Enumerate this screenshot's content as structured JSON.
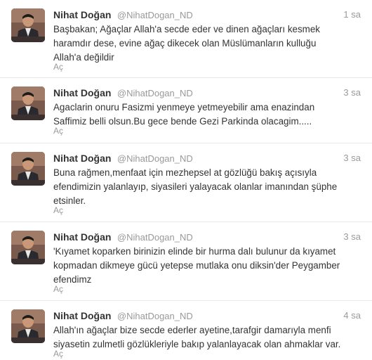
{
  "colors": {
    "name_text": "#333333",
    "meta_text": "#999999",
    "divider": "#e8e8e8",
    "avatar_bg": "#8c6a5a"
  },
  "tweets": [
    {
      "fullname": "Nihat Doğan",
      "username": "@NihatDogan_ND",
      "time": "1 sa",
      "text": "Başbakan; Ağaçlar Allah'a secde eder ve dinen ağaçları kesmek\nharamdır dese, evine ağaç dikecek olan Müslümanların kulluğu\nAllah'a değildir",
      "expand": "Aç"
    },
    {
      "fullname": "Nihat Doğan",
      "username": "@NihatDogan_ND",
      "time": "3 sa",
      "text": "Agaclarin onuru Fasizmi yenmeye yetmeyebilir ama enazindan\nSaffimiz belli olsun.Bu gece bende Gezi Parkinda olacagim.....",
      "expand": "Aç"
    },
    {
      "fullname": "Nihat Doğan",
      "username": "@NihatDogan_ND",
      "time": "3 sa",
      "text": "Buna rağmen,menfaat için mezhepsel at gözlüğü bakış açısıyla\nefendimizin yalanlayıp, siyasileri yalayacak olanlar imanından şüphe\netsinler.",
      "expand": "Aç"
    },
    {
      "fullname": "Nihat Doğan",
      "username": "@NihatDogan_ND",
      "time": "3 sa",
      "text": "'Kıyamet koparken birinizin elinde bir hurma dalı bulunur da kıyamet\nkopmadan dikmeye gücü yetерse mutlaka onu diksin'der Peygamber\nefendimz",
      "expand": "Aç"
    },
    {
      "fullname": "Nihat Doğan",
      "username": "@NihatDogan_ND",
      "time": "4 sa",
      "text": "Allah'ın ağaçlar bize secde ederler ayetine,tarafgir damarıyla menfi\nsiyasetin zulmetli gözlükleriyle bakıp yalanlayacak olan ahmaklar var.",
      "expand": "Aç"
    }
  ]
}
